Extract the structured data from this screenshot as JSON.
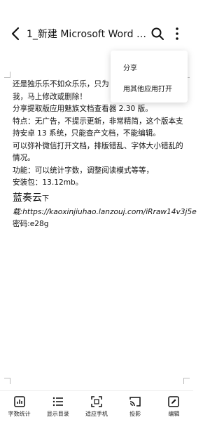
{
  "header": {
    "title": "1_新建 Microsoft Word 文…"
  },
  "menu": {
    "items": [
      "分享",
      "用其他应用打开"
    ]
  },
  "document": {
    "lines": [
      "还是独乐乐不如众乐乐，只为",
      "我，马上修改或删除！",
      "分享提取版应用魅族文档查看器 2.30 版。",
      "特点：无广告，不提示更新，非常精简，这个版本支",
      "持安卓 13 系统，只能查产文档，不能编辑。",
      "可以弥补微信打开文档，排版错乱、字体大小错乱的",
      "情况。",
      "功能：可以统计字数，调整阅读模式等等，",
      "安装包：13.12mb。"
    ],
    "heading_main": "蓝奏云",
    "heading_small": "下",
    "link_line": "载:https://kaoxinjiuhao.lanzouj.com/iRraw14v3j5e",
    "password_line": "密码:e28g"
  },
  "bottom_bar": {
    "items": [
      {
        "label": "字数统计",
        "icon": "chart-icon"
      },
      {
        "label": "显示目录",
        "icon": "list-icon"
      },
      {
        "label": "适应手机",
        "icon": "fit-screen-icon"
      },
      {
        "label": "投影",
        "icon": "cast-icon"
      },
      {
        "label": "编辑",
        "icon": "edit-icon"
      }
    ]
  }
}
